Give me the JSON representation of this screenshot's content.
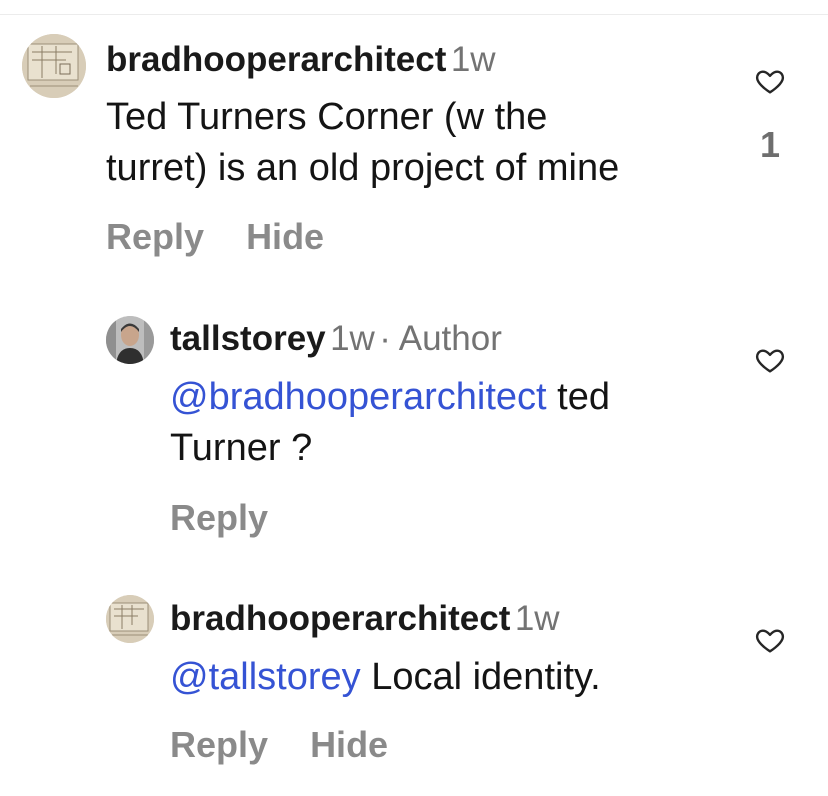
{
  "comments": [
    {
      "username": "bradhooperarchitect",
      "time": "1w",
      "author_tag": "",
      "mention": "",
      "text_line1": "Ted Turners Corner (w the",
      "text_line2": "turret) is an old project of mine",
      "reply_label": "Reply",
      "hide_label": "Hide",
      "like_count": "1",
      "avatar_icon": "sketch-avatar"
    },
    {
      "username": "tallstorey",
      "time": "1w",
      "author_tag": "· Author",
      "mention": "@bradhooperarchitect",
      "text_line1_after_mention": " ted",
      "text_line2": "Turner ?",
      "reply_label": "Reply",
      "avatar_icon": "person-avatar"
    },
    {
      "username": "bradhooperarchitect",
      "time": "1w",
      "mention": "@tallstorey",
      "text_after_mention": " Local identity.",
      "reply_label": "Reply",
      "hide_label": "Hide",
      "avatar_icon": "sketch-avatar"
    }
  ],
  "colors": {
    "mention": "#3553d4",
    "meta": "#737373",
    "action": "#8a8a8a"
  }
}
